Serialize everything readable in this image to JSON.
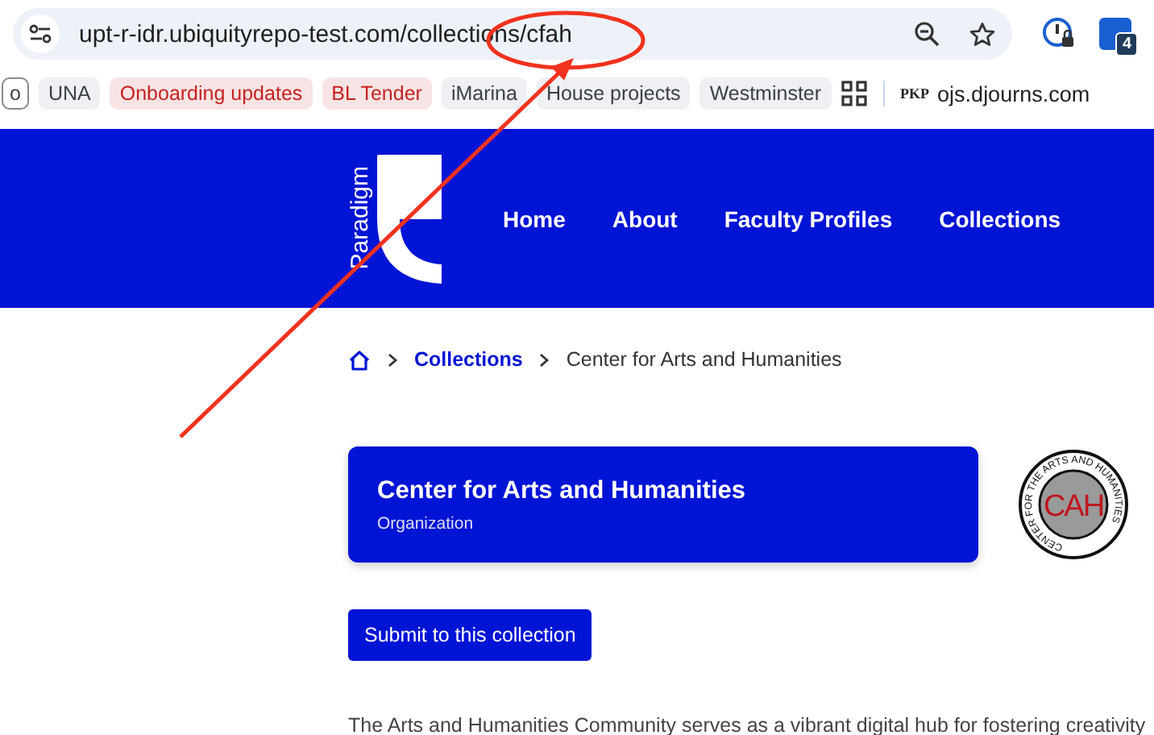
{
  "address_bar": {
    "url": "upt-r-idr.ubiquityrepo-test.com/collections/cfah"
  },
  "extension_badge": "4",
  "bookmarks": [
    {
      "label": "o",
      "color": "#3c4043"
    },
    {
      "label": "UNA",
      "color": "#3c4043"
    },
    {
      "label": "Onboarding updates",
      "color": "#c5221f"
    },
    {
      "label": "BL Tender",
      "color": "#c5221f"
    },
    {
      "label": "iMarina",
      "color": "#3c4043"
    },
    {
      "label": "House projects",
      "color": "#3c4043"
    },
    {
      "label": "Westminster",
      "color": "#3c4043"
    }
  ],
  "bookmark_site": {
    "favicon": "PKP",
    "label": "ojs.djourns.com"
  },
  "site_header": {
    "logo_text": "Paradigm",
    "nav": [
      "Home",
      "About",
      "Faculty Profiles",
      "Collections"
    ]
  },
  "breadcrumb": {
    "link": "Collections",
    "current": "Center for Arts and Humanities"
  },
  "collection": {
    "title": "Center for Arts and Humanities",
    "type": "Organization",
    "logo_ring_text": "CENTER FOR THE ARTS AND HUMANITIES",
    "logo_letters": "CAH"
  },
  "submit_button": "Submit to this collection",
  "description": "The Arts and Humanities Community serves as a vibrant digital hub for fostering creativity"
}
